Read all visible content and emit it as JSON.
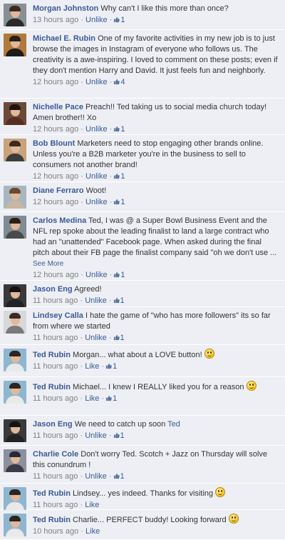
{
  "labels": {
    "unlike": "Unlike",
    "like": "Like",
    "separator": "·",
    "see_more": "See More"
  },
  "comments": [
    {
      "author": "Morgan Johnston",
      "text": "Why can't I like this more than once?",
      "time": "13 hours ago",
      "action": "Unlike",
      "likes": "1",
      "avatar": "man-dark-shirt",
      "colors": {
        "bg": "#8a8f94",
        "hair": "#3a2b22",
        "shirt": "#2a2a2a"
      }
    },
    {
      "author": "Michael E. Rubin",
      "text": "One of my favorite activities in my new job is to just browse the images in Instagram of everyone who follows us. The creativity is a awe-inspiring. I loved to comment on these posts; even if they don't mention Harry and David. It just feels fun and neighborly.",
      "time": "12 hours ago",
      "action": "Unlike",
      "likes": "4",
      "avatar": "man-glasses",
      "colors": {
        "bg": "#b07a3c",
        "hair": "#2a1e17",
        "shirt": "#1c1c1c"
      }
    },
    {
      "author": "Nichelle Pace",
      "text": "Preach!! Ted taking us to social media church today! Amen brother!! Xo",
      "time": "12 hours ago",
      "action": "Unlike",
      "likes": "1",
      "avatar": "woman-group",
      "colors": {
        "bg": "#6b4a3a",
        "hair": "#1e1410",
        "shirt": "#5a2d22"
      }
    },
    {
      "author": "Bob Blount",
      "text": "Marketers need to stop engaging other brands online. Unless you're a B2B marketer you're in the business to sell to consumers not another brand!",
      "time": "12 hours ago",
      "action": "Unlike",
      "likes": "1",
      "avatar": "couple",
      "colors": {
        "bg": "#c9a27a",
        "hair": "#3b2a1e",
        "shirt": "#3c3c3c"
      }
    },
    {
      "author": "Diane Ferraro",
      "text": "Woot!",
      "time": "12 hours ago",
      "action": "Unlike",
      "likes": "1",
      "avatar": "woman-outdoor",
      "colors": {
        "bg": "#a9b6c0",
        "hair": "#6a4a32",
        "shirt": "#c8b6a0"
      }
    },
    {
      "author": "Carlos Medina",
      "text": "Ted, I was @ a Super Bowl Business Event and the NFL rep spoke about the leading finalist to land a large contract who had an \"unattended\" Facebook page. When asked during the final pitch about their FB page the finalist company said \"oh we don't use ...",
      "time": "12 hours ago",
      "action": "Unlike",
      "likes": "1",
      "avatar": "man-smiling",
      "colors": {
        "bg": "#7f8c95",
        "hair": "#2c2016",
        "shirt": "#4a4a4a"
      }
    },
    {
      "author": "Jason Eng",
      "text": "Agreed!",
      "time": "11 hours ago",
      "action": "Unlike",
      "likes": "1",
      "avatar": "man-suit-dark",
      "colors": {
        "bg": "#3a3a3a",
        "hair": "#141414",
        "shirt": "#222222"
      }
    },
    {
      "author": "Lindsey Calla",
      "text": "I hate the game of \"who has more followers\" its so far from where we started",
      "time": "11 hours ago",
      "action": "Unlike",
      "likes": "1",
      "avatar": "woman-curly",
      "colors": {
        "bg": "#d8d8d8",
        "hair": "#3a2a24",
        "shirt": "#7a7a7a"
      }
    },
    {
      "author": "Ted Rubin",
      "text": "Morgan... what about a LOVE button!",
      "time": "11 hours ago",
      "action": "Like",
      "likes": "1",
      "emoji": true,
      "avatar": "man-surfboards",
      "colors": {
        "bg": "#8fb6cf",
        "hair": "#2e2520",
        "shirt": "#e9e9e9"
      }
    },
    {
      "author": "Ted Rubin",
      "text": "Michael... I knew I REALLY liked you for a reason",
      "time": "11 hours ago",
      "action": "Like",
      "likes": "1",
      "emoji": true,
      "avatar": "man-surfboards",
      "colors": {
        "bg": "#8fb6cf",
        "hair": "#2e2520",
        "shirt": "#e9e9e9"
      }
    },
    {
      "author": "Jason Eng",
      "text": "We need to catch up soon",
      "mention": "Ted",
      "time": "11 hours ago",
      "action": "Unlike",
      "likes": "1",
      "avatar": "man-suit-dark",
      "colors": {
        "bg": "#3a3a3a",
        "hair": "#141414",
        "shirt": "#222222"
      }
    },
    {
      "author": "Charlie Cole",
      "text": "Don't worry Ted. Scotch + Jazz on Thursday will solve this conundrum !",
      "time": "11 hours ago",
      "action": "Unlike",
      "likes": "1",
      "avatar": "sunset-silhouette",
      "colors": {
        "bg": "#8c8f9c",
        "hair": "#2a2a35",
        "shirt": "#3a3a48"
      }
    },
    {
      "author": "Ted Rubin",
      "text": "Lindsey... yes indeed. Thanks for visiting",
      "time": "11 hours ago",
      "action": "Like",
      "emoji": true,
      "avatar": "man-surfboards",
      "colors": {
        "bg": "#8fb6cf",
        "hair": "#2e2520",
        "shirt": "#e9e9e9"
      }
    },
    {
      "author": "Ted Rubin",
      "text": "Charlie... PERFECT buddy! Looking forward",
      "time": "10 hours ago",
      "action": "Like",
      "emoji": true,
      "avatar": "man-surfboards",
      "colors": {
        "bg": "#8fb6cf",
        "hair": "#2e2520",
        "shirt": "#e9e9e9"
      }
    }
  ]
}
